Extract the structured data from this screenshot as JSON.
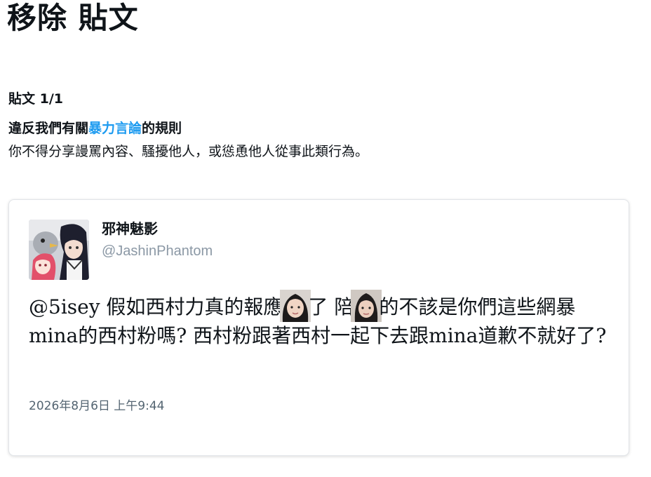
{
  "page": {
    "title": "移除 貼文"
  },
  "report": {
    "post_count": "貼文 1/1",
    "rule_prefix": "違反我們有關",
    "rule_link": "暴力言論",
    "rule_suffix": "的規則",
    "description": "你不得分享謾罵內容、騷擾他人，或慫恿他人從事此類行為。"
  },
  "tweet": {
    "author_name": "邪神魅影",
    "author_handle": "@JashinPhantom",
    "body_seg1": "@5isey 假如西村力真的報應",
    "body_seg2": "了 陪",
    "body_seg3": "的不該是你們這些網暴mina的西村粉嗎? 西村粉跟著西村一起下去跟mina道歉不就好了?",
    "timestamp": "2026年8月6日 上午9:44",
    "avatar_icon": "anime-characters-avatar",
    "inline_images": [
      "face-photo-icon",
      "face-photo-icon"
    ]
  },
  "colors": {
    "link": "#1d9bf0",
    "handle": "#8b98a5",
    "timestamp": "#536471"
  }
}
